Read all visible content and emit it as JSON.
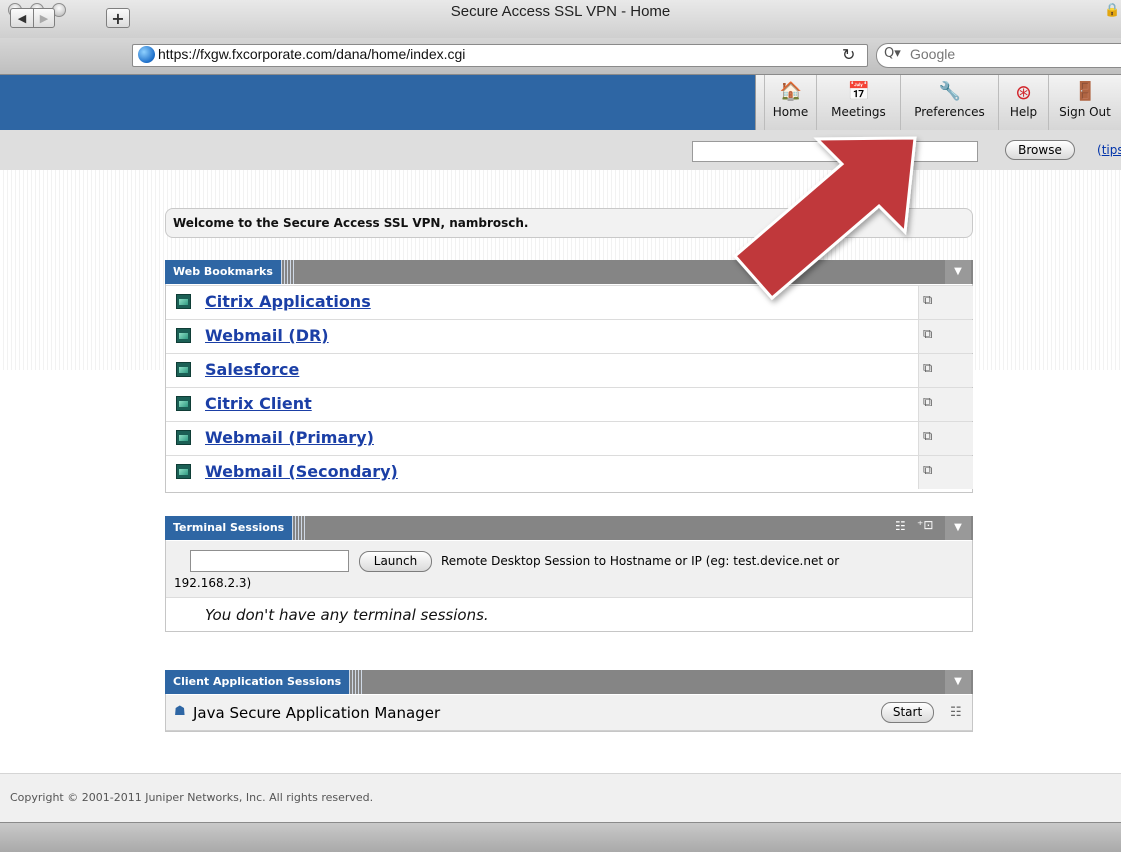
{
  "window": {
    "title": "Secure Access SSL VPN - Home"
  },
  "toolbar": {
    "back": "◀",
    "forward": "▶",
    "add": "+",
    "url": "https://fxgw.fxcorporate.com/dana/home/index.cgi",
    "reload": "↻",
    "search_placeholder": "Google",
    "search_icon": "Q▾"
  },
  "nav": [
    {
      "label": "Home",
      "icon": "home-icon",
      "glyph": "🏠"
    },
    {
      "label": "Meetings",
      "icon": "calendar-icon",
      "glyph": "📅"
    },
    {
      "label": "Preferences",
      "icon": "wrench-icon",
      "glyph": "🔧"
    },
    {
      "label": "Help",
      "icon": "lifebuoy-icon",
      "glyph": "⊛"
    },
    {
      "label": "Sign Out",
      "icon": "door-icon",
      "glyph": "🚪"
    }
  ],
  "browse": {
    "button": "Browse",
    "tips_open": "(",
    "tips": "tips",
    "tips_close": ")"
  },
  "welcome": "Welcome to the Secure Access SSL VPN, nambrosch.",
  "web_bookmarks": {
    "title": "Web Bookmarks",
    "items": [
      "Citrix Applications",
      "Webmail (DR)",
      "Salesforce",
      "Citrix Client",
      "Webmail (Primary)",
      "Webmail (Secondary)"
    ]
  },
  "terminal": {
    "title": "Terminal Sessions",
    "launch": "Launch",
    "description": "Remote Desktop Session to Hostname or IP (eg: test.device.net or",
    "description_2": "192.168.2.3)",
    "empty": "You don't have any terminal sessions."
  },
  "client_apps": {
    "title": "Client Application Sessions",
    "item": "Java Secure Application Manager",
    "start": "Start"
  },
  "footer": "Copyright © 2001-2011 Juniper Networks, Inc. All rights reserved.",
  "colors": {
    "accent": "#2e66a4",
    "arrow": "#c0393b",
    "link": "#1b3fa6"
  }
}
